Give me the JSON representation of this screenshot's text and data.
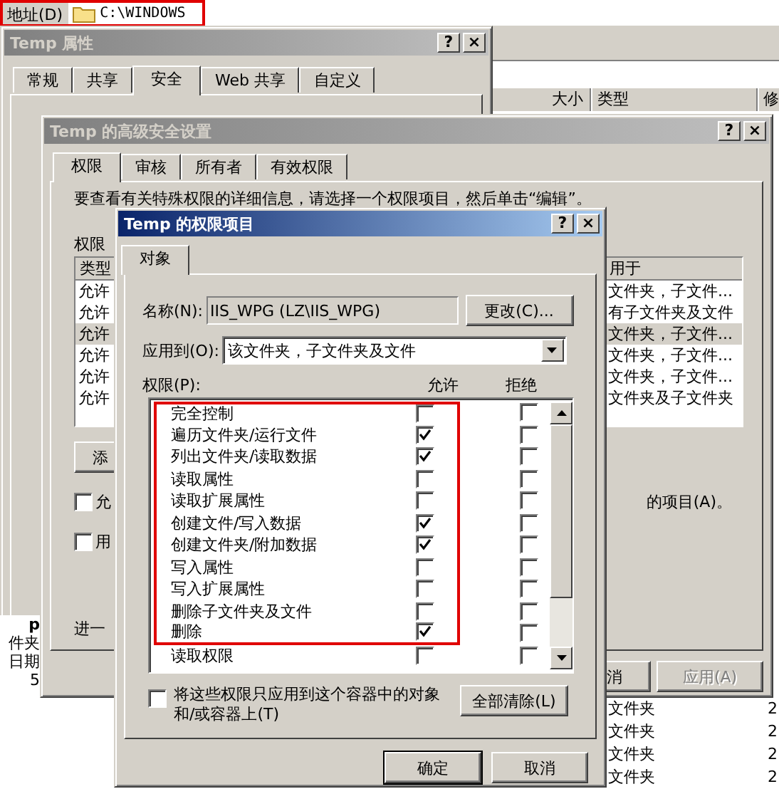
{
  "address_bar": {
    "label": "地址(D)",
    "value": "C:\\WINDOWS"
  },
  "explorer": {
    "columns": [
      "大小",
      "类型",
      "修"
    ],
    "details": [
      "p",
      "件夹",
      "日期",
      "5"
    ],
    "rows": [
      {
        "type": "文件夹",
        "date": "2"
      },
      {
        "type": "文件夹",
        "date": "2"
      },
      {
        "type": "文件夹",
        "date": "2"
      },
      {
        "type": "文件夹",
        "date": "2"
      }
    ]
  },
  "properties_window": {
    "title": "Temp 属性",
    "active": false,
    "title_buttons": [
      "?",
      "×"
    ],
    "tabs": [
      {
        "label": "常规",
        "selected": false
      },
      {
        "label": "共享",
        "selected": false
      },
      {
        "label": "安全",
        "selected": true
      },
      {
        "label": "Web 共享",
        "selected": false
      },
      {
        "label": "自定义",
        "selected": false
      }
    ]
  },
  "advanced_window": {
    "title": "Temp 的高级安全设置",
    "active": false,
    "title_buttons": [
      "?",
      "×"
    ],
    "tabs": [
      {
        "label": "权限",
        "selected": true
      },
      {
        "label": "审核",
        "selected": false
      },
      {
        "label": "所有者",
        "selected": false
      },
      {
        "label": "有效权限",
        "selected": false
      }
    ],
    "info": "要查看有关特殊权限的详细信息，请选择一个权限项目，然后单击“编辑”。",
    "list_label": "权限",
    "columns": [
      "类型",
      "用于"
    ],
    "entries": [
      {
        "type": "允许",
        "applies_to": "文件夹，子文件...",
        "selected": false
      },
      {
        "type": "允许",
        "applies_to": "有子文件夹及文件",
        "selected": false
      },
      {
        "type": "允许",
        "applies_to": "文件夹，子文件...",
        "selected": true
      },
      {
        "type": "允许",
        "applies_to": "文件夹，子文件...",
        "selected": false
      },
      {
        "type": "允许",
        "applies_to": "文件夹，子文件...",
        "selected": false
      },
      {
        "type": "允许",
        "applies_to": "文件夹及子文件夹",
        "selected": false
      }
    ],
    "add_button": "添",
    "options": [
      {
        "label": "允",
        "checked": false,
        "note": "的项目(A)。"
      },
      {
        "label": "用",
        "checked": false
      }
    ],
    "more": "进一",
    "buttons": [
      {
        "label": "消",
        "disabled": false
      },
      {
        "label": "应用(A)",
        "disabled": true
      }
    ]
  },
  "entry_window": {
    "title": "Temp 的权限项目",
    "active": true,
    "title_buttons": [
      "?",
      "×"
    ],
    "tabs": [
      {
        "label": "对象",
        "selected": true
      }
    ],
    "name_label": "名称(N):",
    "name_value": "IIS_WPG (LZ\\IIS_WPG)",
    "change_button": "更改(C)...",
    "apply_label": "应用到(O):",
    "apply_value": "该文件夹，子文件夹及文件",
    "permissions_label": "权限(P):",
    "allow_header": "允许",
    "deny_header": "拒绝",
    "permissions": [
      {
        "name": "完全控制",
        "allow": false,
        "deny": false,
        "highlighted": true
      },
      {
        "name": "遍历文件夹/运行文件",
        "allow": true,
        "deny": false,
        "highlighted": true
      },
      {
        "name": "列出文件夹/读取数据",
        "allow": true,
        "deny": false,
        "highlighted": true
      },
      {
        "name": "读取属性",
        "allow": false,
        "deny": false,
        "highlighted": true
      },
      {
        "name": "读取扩展属性",
        "allow": false,
        "deny": false,
        "highlighted": true
      },
      {
        "name": "创建文件/写入数据",
        "allow": true,
        "deny": false,
        "highlighted": true
      },
      {
        "name": "创建文件夹/附加数据",
        "allow": true,
        "deny": false,
        "highlighted": true
      },
      {
        "name": "写入属性",
        "allow": false,
        "deny": false,
        "highlighted": true
      },
      {
        "name": "写入扩展属性",
        "allow": false,
        "deny": false,
        "highlighted": true
      },
      {
        "name": "删除子文件夹及文件",
        "allow": false,
        "deny": false,
        "highlighted": true
      },
      {
        "name": "删除",
        "allow": true,
        "deny": false,
        "highlighted": true
      },
      {
        "name": "读取权限",
        "allow": false,
        "deny": false,
        "highlighted": false
      }
    ],
    "container_only": {
      "label": "将这些权限只应用到这个容器中的对象和/或容器上(T)",
      "checked": false
    },
    "clear_button": "全部清除(L)",
    "buttons": [
      "确定",
      "取消"
    ]
  }
}
